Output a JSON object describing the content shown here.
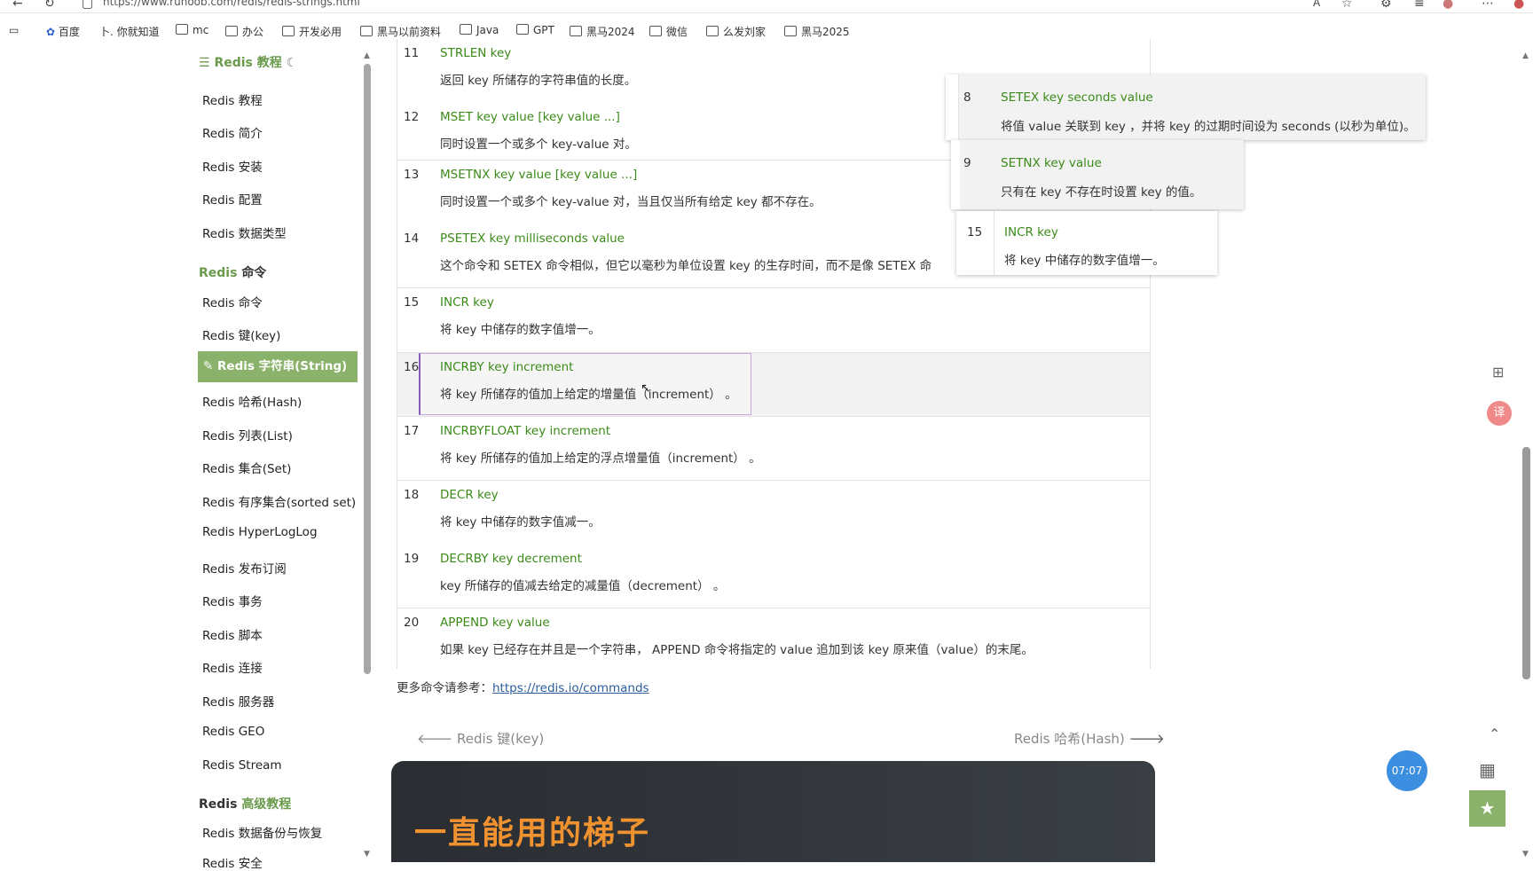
{
  "browser": {
    "url": "https://www.runoob.com/redis/redis-strings.html",
    "bookmarks": [
      "百度",
      "卜. 你就知道",
      "mc",
      "办公",
      "开发必用",
      "黑马以前资料",
      "Java",
      "GPT",
      "黑马2024",
      "微信",
      "么发刘家",
      "黑马2025"
    ]
  },
  "sidebar": {
    "tutorial_header": "Redis 教程",
    "tutorial_items": [
      "Redis 教程",
      "Redis 简介",
      "Redis 安装",
      "Redis 配置",
      "Redis 数据类型"
    ],
    "commands_header": {
      "prefix": "Redis",
      "suffix": "命令"
    },
    "command_items": [
      "Redis 命令",
      "Redis 键(key)",
      "Redis 字符串(String)",
      "Redis 哈希(Hash)",
      "Redis 列表(List)",
      "Redis 集合(Set)",
      "Redis 有序集合(sorted set)",
      "Redis HyperLogLog",
      "Redis 发布订阅",
      "Redis 事务",
      "Redis 脚本",
      "Redis 连接",
      "Redis 服务器",
      "Redis GEO",
      "Redis Stream"
    ],
    "advanced_header": {
      "prefix": "Redis",
      "suffix": "高级教程"
    },
    "advanced_items": [
      "Redis 数据备份与恢复",
      "Redis 安全"
    ]
  },
  "table_rows": [
    {
      "num": "11",
      "cmd": "STRLEN key",
      "desc": "返回 key 所储存的字符串值的长度。"
    },
    {
      "num": "12",
      "cmd": "MSET key value [key value ...]",
      "desc": "同时设置一个或多个 key-value 对。"
    },
    {
      "num": "13",
      "cmd": "MSETNX key value [key value ...]",
      "desc": "同时设置一个或多个 key-value 对，当且仅当所有给定 key 都不存在。"
    },
    {
      "num": "14",
      "cmd": "PSETEX key milliseconds value",
      "desc": "这个命令和 SETEX 命令相似，但它以毫秒为单位设置 key 的生存时间，而不是像 SETEX 命"
    },
    {
      "num": "15",
      "cmd": "INCR key",
      "desc": "将 key 中储存的数字值增一。"
    },
    {
      "num": "16",
      "cmd": "INCRBY key increment",
      "desc": "将 key 所储存的值加上给定的增量值（increment） 。"
    },
    {
      "num": "17",
      "cmd": "INCRBYFLOAT key increment",
      "desc": "将 key 所储存的值加上给定的浮点增量值（increment） 。"
    },
    {
      "num": "18",
      "cmd": "DECR key",
      "desc": "将 key 中储存的数字值减一。"
    },
    {
      "num": "19",
      "cmd": "DECRBY key decrement",
      "desc": "key 所储存的值减去给定的减量值（decrement） 。"
    },
    {
      "num": "20",
      "cmd": "APPEND key value",
      "desc": "如果 key 已经存在并且是一个字符串， APPEND 命令将指定的 value 追加到该 key 原来值（value）的末尾。"
    }
  ],
  "floating": [
    {
      "num": "8",
      "cmd": "SETEX key seconds value",
      "desc": "将值 value 关联到 key ，并将 key 的过期时间设为 seconds (以秒为单位)。"
    },
    {
      "num": "9",
      "cmd": "SETNX key value",
      "desc": "只有在 key 不存在时设置 key 的值。"
    },
    {
      "num": "15",
      "cmd": "INCR key",
      "desc": "将 key 中储存的数字值增一。"
    }
  ],
  "more": {
    "prefix": "更多命令请参考：",
    "link": "https://redis.io/commands"
  },
  "nav": {
    "prev": "Redis 键(key)",
    "next": "Redis 哈希(Hash)"
  },
  "promo": {
    "title": "一直能用的梯子"
  },
  "widgets": {
    "timer": "07:07"
  },
  "colors": {
    "accent_green": "#8ab26a",
    "command_green": "#3b8a19",
    "promo_orange": "#f0922f"
  }
}
